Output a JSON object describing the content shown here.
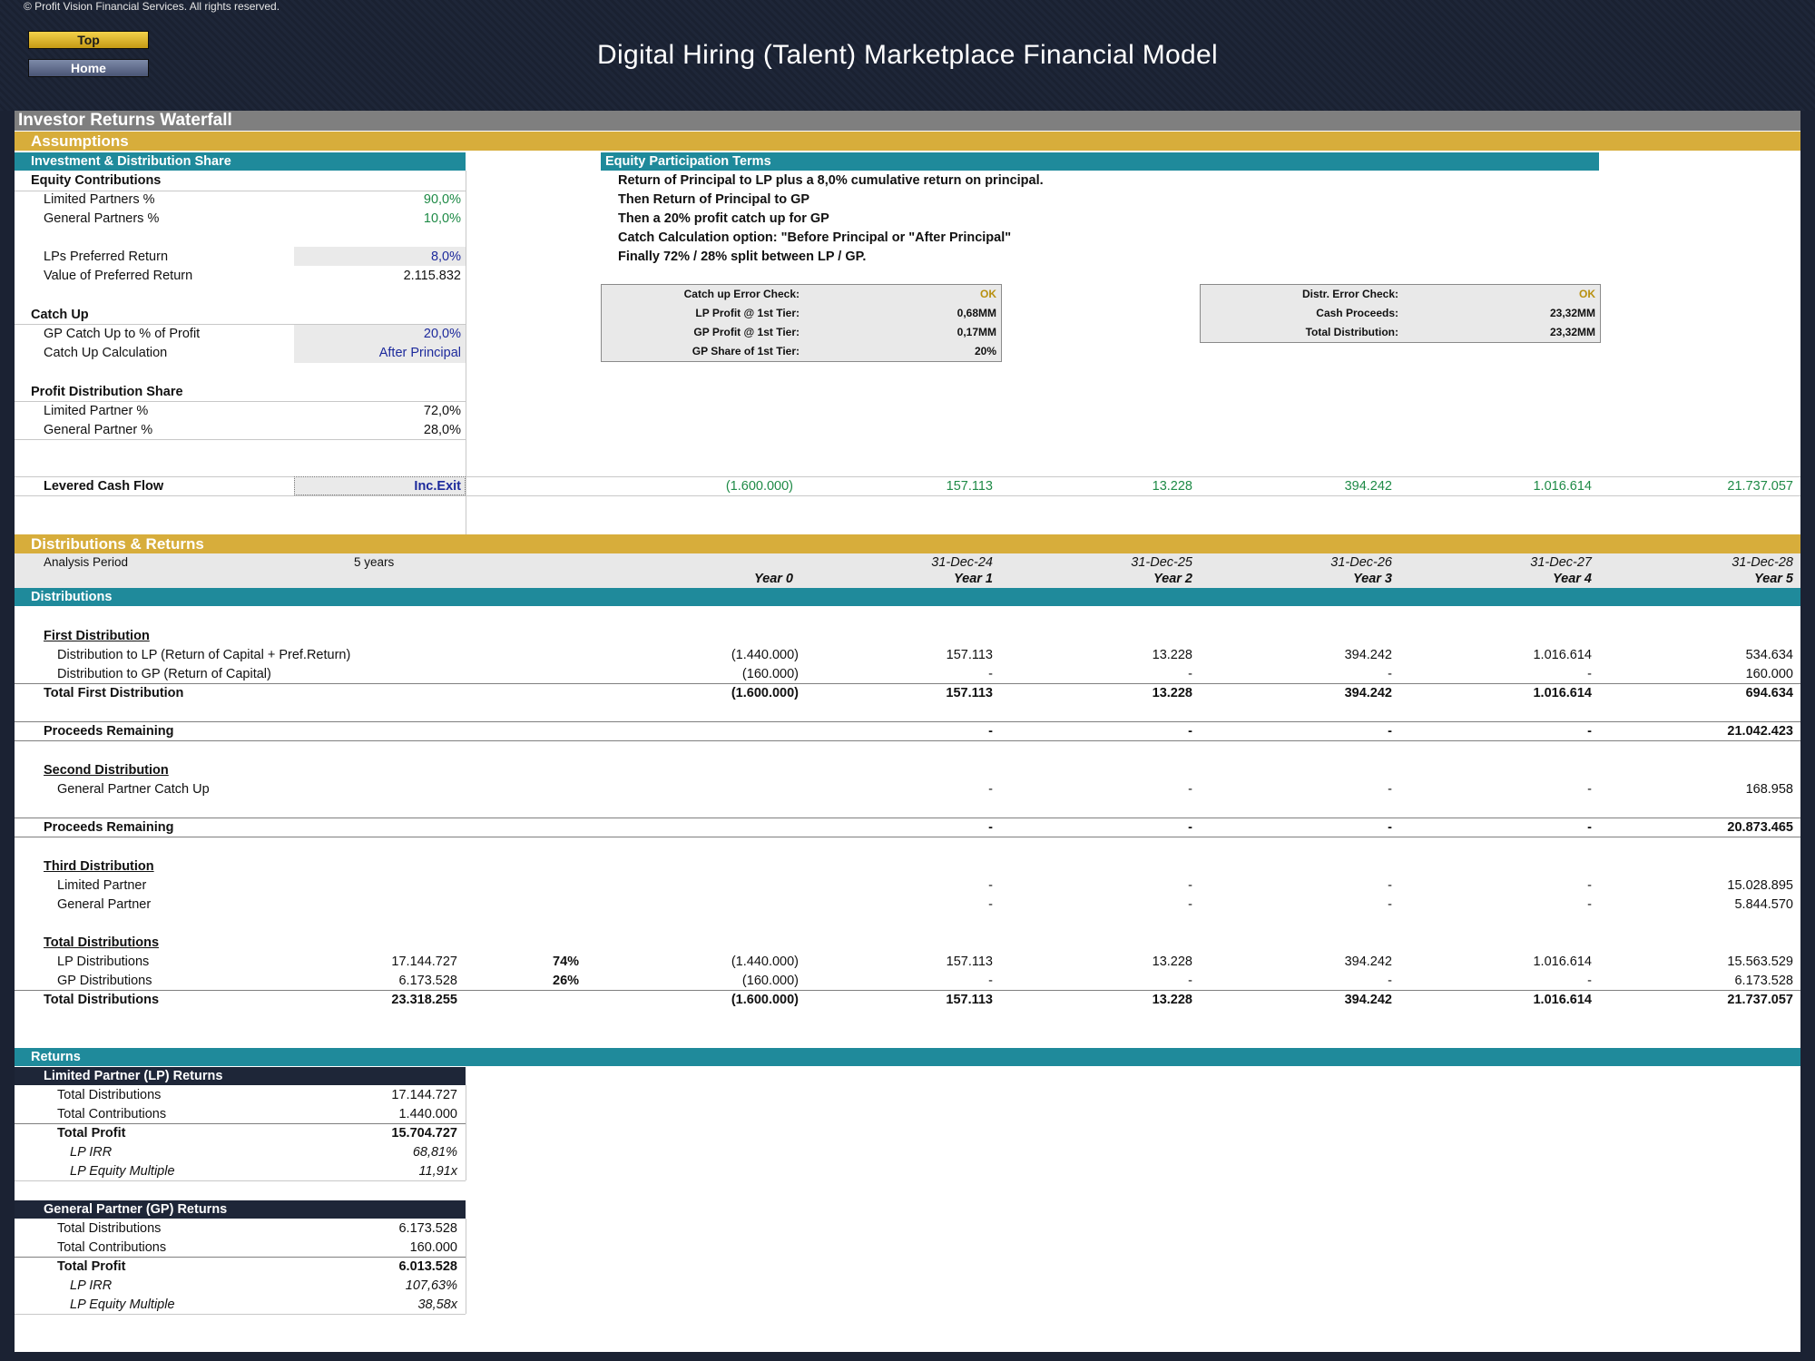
{
  "header": {
    "copyright": "© Profit Vision Financial Services. All rights reserved.",
    "top_button": "Top",
    "home_button": "Home",
    "title": "Digital Hiring (Talent) Marketplace Financial Model"
  },
  "sheet_title": "Investor Returns Waterfall",
  "assumptions": {
    "section_label": "Assumptions",
    "left_header": "Investment & Distribution Share",
    "equity_contributions": {
      "label": "Equity Contributions",
      "lp_label": "Limited Partners %",
      "lp_value": "90,0%",
      "gp_label": "General Partners %",
      "gp_value": "10,0%"
    },
    "pref_return": {
      "label": "LPs Preferred Return",
      "value": "8,0%",
      "value_label": "Value of Preferred Return",
      "value_amount": "2.115.832"
    },
    "catch_up": {
      "label": "Catch Up",
      "gp_label": "GP Catch Up to % of Profit",
      "gp_value": "20,0%",
      "calc_label": "Catch Up Calculation",
      "calc_value": "After Principal"
    },
    "profit_share": {
      "label": "Profit Distribution Share",
      "lp_label": "Limited Partner %",
      "lp_value": "72,0%",
      "gp_label": "General Partner %",
      "gp_value": "28,0%"
    },
    "terms_header": "Equity Participation Terms",
    "terms": [
      "Return of Principal to LP plus a 8,0% cumulative return on principal.",
      "Then Return of Principal to GP",
      "Then a 20% profit catch up for GP",
      "Catch Calculation option: \"Before Principal or \"After Principal\"",
      "Finally 72% / 28% split between LP / GP."
    ],
    "check_box_1": {
      "rows": [
        {
          "label": "Catch up Error Check:",
          "value": "OK"
        },
        {
          "label": "LP Profit @ 1st Tier:",
          "value": "0,68MM"
        },
        {
          "label": "GP Profit @ 1st Tier:",
          "value": "0,17MM"
        },
        {
          "label": "GP Share of 1st Tier:",
          "value": "20%"
        }
      ]
    },
    "check_box_2": {
      "rows": [
        {
          "label": "Distr. Error Check:",
          "value": "OK"
        },
        {
          "label": "Cash Proceeds:",
          "value": "23,32MM"
        },
        {
          "label": "Total Distribution:",
          "value": "23,32MM"
        }
      ]
    },
    "levered_cash_flow": {
      "label": "Levered Cash Flow",
      "option": "Inc.Exit",
      "values": [
        "(1.600.000)",
        "157.113",
        "13.228",
        "394.242",
        "1.016.614",
        "21.737.057"
      ]
    }
  },
  "distributions_returns": {
    "section_label": "Distributions & Returns",
    "analysis_period_label": "Analysis Period",
    "analysis_period_value": "5 years",
    "dates": [
      "31-Dec-24",
      "31-Dec-25",
      "31-Dec-26",
      "31-Dec-27",
      "31-Dec-28"
    ],
    "years": [
      "Year 0",
      "Year 1",
      "Year 2",
      "Year 3",
      "Year 4",
      "Year 5"
    ],
    "distributions_header": "Distributions",
    "first": {
      "label": "First Distribution",
      "lp_label": "Distribution to LP (Return of Capital + Pref.Return)",
      "lp_values": [
        "(1.440.000)",
        "157.113",
        "13.228",
        "394.242",
        "1.016.614",
        "534.634"
      ],
      "gp_label": "Distribution to GP (Return of Capital)",
      "gp_values": [
        "(160.000)",
        "-",
        "-",
        "-",
        "-",
        "160.000"
      ],
      "total_label": "Total First Distribution",
      "total_values": [
        "(1.600.000)",
        "157.113",
        "13.228",
        "394.242",
        "1.016.614",
        "694.634"
      ],
      "remaining_label": "Proceeds Remaining",
      "remaining_values": [
        "",
        "-",
        "-",
        "-",
        "-",
        "21.042.423"
      ]
    },
    "second": {
      "label": "Second Distribution",
      "catchup_label": "General Partner Catch Up",
      "catchup_values": [
        "",
        "-",
        "-",
        "-",
        "-",
        "168.958"
      ],
      "remaining_label": "Proceeds Remaining",
      "remaining_values": [
        "",
        "-",
        "-",
        "-",
        "-",
        "20.873.465"
      ]
    },
    "third": {
      "label": "Third Distribution",
      "lp_label": "Limited Partner",
      "lp_values": [
        "",
        "-",
        "-",
        "-",
        "-",
        "15.028.895"
      ],
      "gp_label": "General Partner",
      "gp_values": [
        "",
        "-",
        "-",
        "-",
        "-",
        "5.844.570"
      ]
    },
    "totals": {
      "label": "Total Distributions",
      "lp_label": "LP Distributions",
      "lp_sum": "17.144.727",
      "lp_pct": "74%",
      "lp_values": [
        "(1.440.000)",
        "157.113",
        "13.228",
        "394.242",
        "1.016.614",
        "15.563.529"
      ],
      "gp_label": "GP Distributions",
      "gp_sum": "6.173.528",
      "gp_pct": "26%",
      "gp_values": [
        "(160.000)",
        "-",
        "-",
        "-",
        "-",
        "6.173.528"
      ],
      "total_label": "Total Distributions",
      "total_sum": "23.318.255",
      "total_values": [
        "(1.600.000)",
        "157.113",
        "13.228",
        "394.242",
        "1.016.614",
        "21.737.057"
      ]
    },
    "returns_header": "Returns",
    "lp_returns": {
      "header": "Limited Partner (LP) Returns",
      "rows": [
        {
          "label": "Total Distributions",
          "value": "17.144.727"
        },
        {
          "label": "Total Contributions",
          "value": "1.440.000"
        },
        {
          "label": "Total Profit",
          "value": "15.704.727"
        },
        {
          "label": "LP IRR",
          "value": "68,81%"
        },
        {
          "label": "LP Equity Multiple",
          "value": "11,91x"
        }
      ]
    },
    "gp_returns": {
      "header": "General Partner (GP) Returns",
      "rows": [
        {
          "label": "Total Distributions",
          "value": "6.173.528"
        },
        {
          "label": "Total Contributions",
          "value": "160.000"
        },
        {
          "label": "Total Profit",
          "value": "6.013.528"
        },
        {
          "label": "LP IRR",
          "value": "107,63%"
        },
        {
          "label": "LP Equity Multiple",
          "value": "38,58x"
        }
      ]
    }
  }
}
